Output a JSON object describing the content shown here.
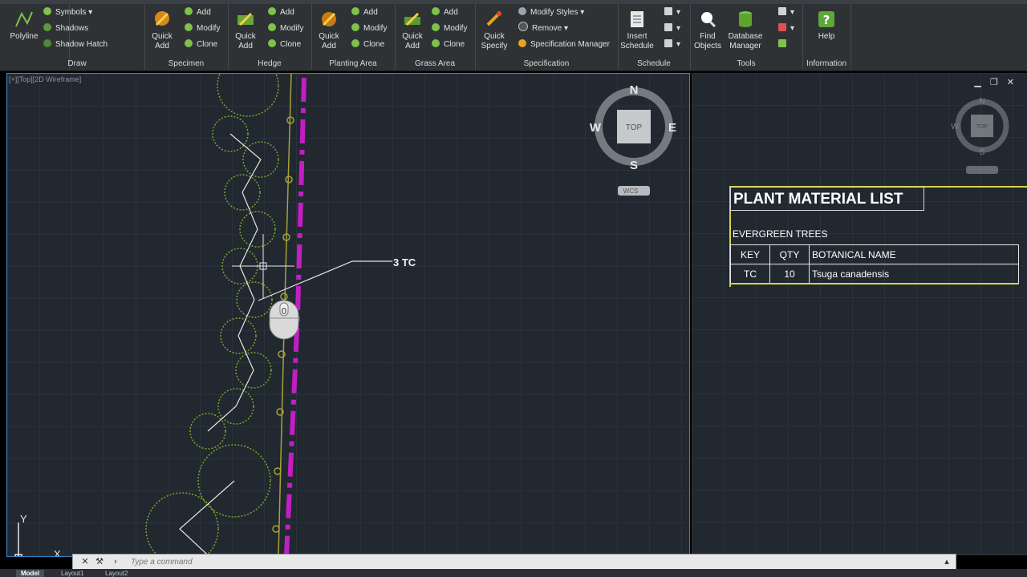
{
  "ribbon": {
    "panels": [
      {
        "title": "Draw",
        "buttons": [
          {
            "label": "Polyline"
          }
        ],
        "small": [
          "Symbols",
          "Shadows",
          "Shadow Hatch"
        ]
      },
      {
        "title": "Specimen",
        "buttons": [
          {
            "label": "Quick Add"
          }
        ],
        "small": [
          "Add",
          "Modify",
          "Clone"
        ]
      },
      {
        "title": "Hedge",
        "buttons": [
          {
            "label": "Quick Add"
          }
        ],
        "small": [
          "Add",
          "Modify",
          "Clone"
        ]
      },
      {
        "title": "Planting Area",
        "buttons": [
          {
            "label": "Quick Add"
          }
        ],
        "small": [
          "Add",
          "Modify",
          "Clone"
        ]
      },
      {
        "title": "Grass Area",
        "buttons": [
          {
            "label": "Quick Add"
          }
        ],
        "small": [
          "Add",
          "Modify",
          "Clone"
        ]
      },
      {
        "title": "Specification",
        "buttons": [
          {
            "label": "Quick Specify"
          }
        ],
        "small": [
          "Modify Styles",
          "Remove",
          "Specification Manager"
        ]
      },
      {
        "title": "Schedule",
        "buttons": [
          {
            "label": "Insert Schedule"
          }
        ]
      },
      {
        "title": "Tools",
        "buttons": [
          {
            "label": "Find Objects"
          },
          {
            "label": "Database Manager"
          }
        ]
      },
      {
        "title": "Information",
        "buttons": [
          {
            "label": "Help"
          }
        ]
      }
    ]
  },
  "viewport": {
    "label": "[+][Top][2D Wireframe]",
    "compass": {
      "n": "N",
      "s": "S",
      "e": "E",
      "w": "W",
      "cube": "TOP",
      "wcs": "WCS"
    },
    "callout": "3 TC",
    "ucs_y": "Y",
    "ucs_x": "X"
  },
  "plant_list": {
    "title": "PLANT MATERIAL LIST",
    "subtitle": "EVERGREEN TREES",
    "headers": [
      "KEY",
      "QTY",
      "BOTANICAL NAME"
    ],
    "rows": [
      [
        "TC",
        "10",
        "Tsuga canadensis"
      ]
    ]
  },
  "command": {
    "placeholder": "Type a command"
  },
  "tabs": [
    "Model",
    "Layout1",
    "Layout2"
  ],
  "colors": {
    "accent": "#3b84c6",
    "canvas": "#212830",
    "plant": "#7aa52a",
    "magenta": "#c21ec4",
    "table_border": "#d7d34c"
  }
}
